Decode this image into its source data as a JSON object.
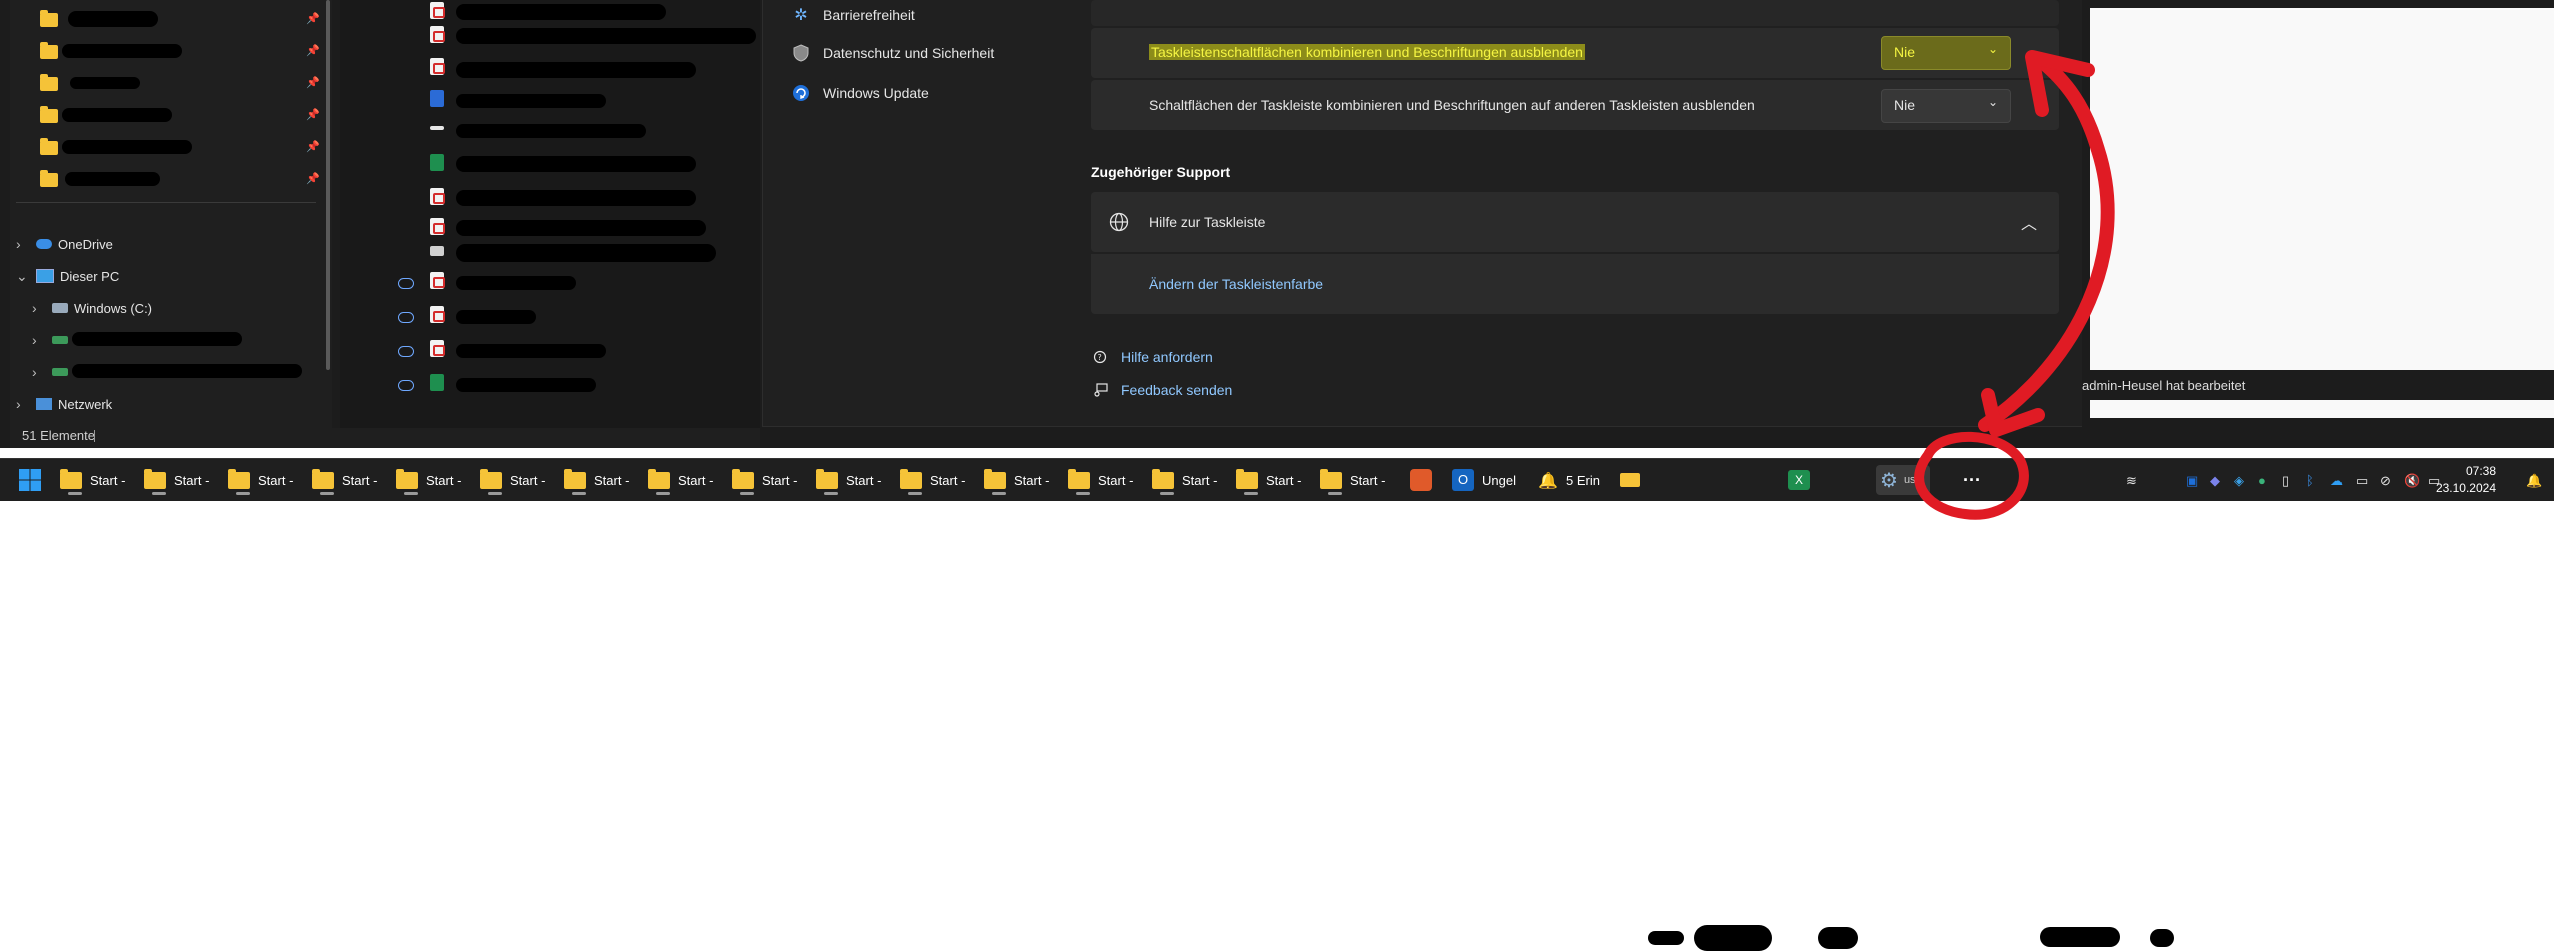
{
  "explorer": {
    "nav": {
      "onedrive": "OneDrive",
      "this_pc": "Dieser PC",
      "windows_c": "Windows (C:)",
      "network": "Netzwerk"
    },
    "status": "51 Elemente"
  },
  "settings": {
    "nav": [
      {
        "label": "Barrierefreiheit",
        "icon": "accessibility-icon"
      },
      {
        "label": "Datenschutz und Sicherheit",
        "icon": "shield-icon"
      },
      {
        "label": "Windows Update",
        "icon": "refresh-icon"
      }
    ],
    "rows": {
      "combine_main": {
        "label": "Taskleistenschaltflächen kombinieren und Beschriftungen ausblenden",
        "value": "Nie"
      },
      "combine_other": {
        "label": "Schaltflächen der Taskleiste kombinieren und Beschriftungen auf anderen Taskleisten ausblenden",
        "value": "Nie"
      }
    },
    "support": {
      "heading": "Zugehöriger Support",
      "help_title": "Hilfe zur Taskleiste",
      "link": "Ändern der Taskleistenfarbe"
    },
    "footer": {
      "help": "Hilfe anfordern",
      "feedback": "Feedback senden"
    }
  },
  "document": {
    "note": "admin-Heusel hat bearbeitet"
  },
  "taskbar": {
    "folder_label": "Start -",
    "apps": [
      "Start -",
      "Start -",
      "Start -",
      "Start -",
      "Start -",
      "Start -",
      "Start -",
      "Start -",
      "Start -",
      "Start -",
      "Start -",
      "Start -",
      "Start -",
      "Start -",
      "Start -",
      "Start -"
    ],
    "outlook": "Ungel",
    "reminders": "5 Erin",
    "settings_partial": "usb",
    "more": "···",
    "time": "07:38",
    "date": "23.10.2024"
  },
  "colors": {
    "accent_link": "#90c8ff",
    "highlight_bg": "#8c8c1a",
    "highlight_fg": "#f5f542",
    "annotation_red": "#e01b24",
    "taskbar_bg": "#1f1f1f"
  }
}
